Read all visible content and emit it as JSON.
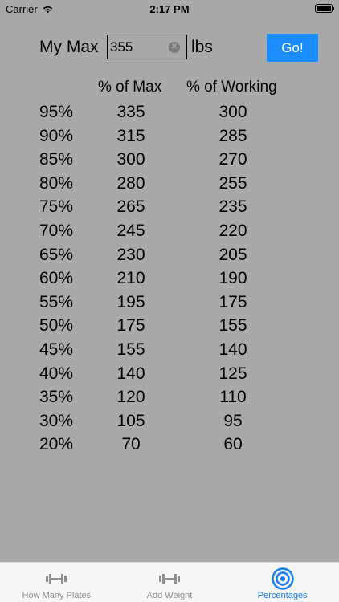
{
  "status": {
    "carrier": "Carrier",
    "time": "2:17 PM"
  },
  "max": {
    "label": "My Max",
    "value": "355",
    "unit": "lbs",
    "go_label": "Go!"
  },
  "headers": {
    "of_max": "% of Max",
    "of_working": "% of Working"
  },
  "rows": [
    {
      "pct": "95%",
      "max": "335",
      "working": "300"
    },
    {
      "pct": "90%",
      "max": "315",
      "working": "285"
    },
    {
      "pct": "85%",
      "max": "300",
      "working": "270"
    },
    {
      "pct": "80%",
      "max": "280",
      "working": "255"
    },
    {
      "pct": "75%",
      "max": "265",
      "working": "235"
    },
    {
      "pct": "70%",
      "max": "245",
      "working": "220"
    },
    {
      "pct": "65%",
      "max": "230",
      "working": "205"
    },
    {
      "pct": "60%",
      "max": "210",
      "working": "190"
    },
    {
      "pct": "55%",
      "max": "195",
      "working": "175"
    },
    {
      "pct": "50%",
      "max": "175",
      "working": "155"
    },
    {
      "pct": "45%",
      "max": "155",
      "working": "140"
    },
    {
      "pct": "40%",
      "max": "140",
      "working": "125"
    },
    {
      "pct": "35%",
      "max": "120",
      "working": "110"
    },
    {
      "pct": "30%",
      "max": "105",
      "working": "95"
    },
    {
      "pct": "20%",
      "max": "70",
      "working": "60"
    }
  ],
  "tabs": [
    {
      "label": "How Many Plates",
      "icon": "dumbbell-icon",
      "active": false
    },
    {
      "label": "Add Weight",
      "icon": "dumbbell-icon",
      "active": false
    },
    {
      "label": "Percentages",
      "icon": "target-icon",
      "active": true
    }
  ],
  "colors": {
    "background": "#a9a9a9",
    "accent": "#1a8cff",
    "tab_active": "#1a7df0"
  }
}
